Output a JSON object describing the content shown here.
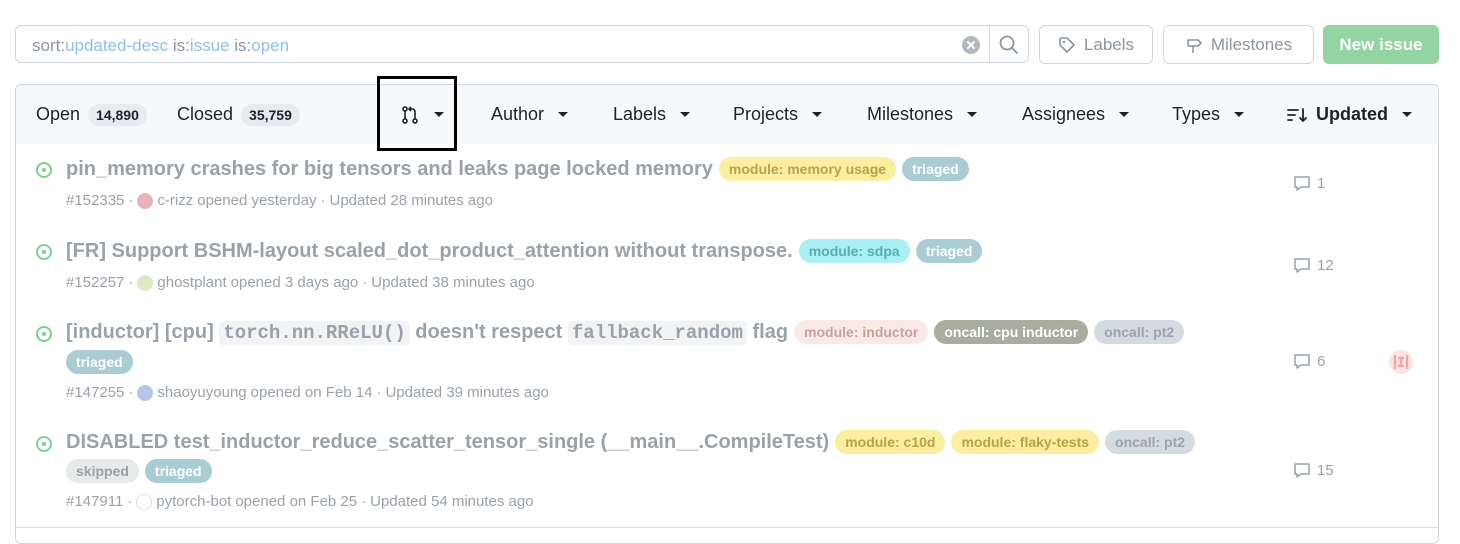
{
  "search": {
    "parts": [
      {
        "k": "sort:",
        "v": "updated-desc"
      },
      {
        "k": " is:",
        "v": "issue"
      },
      {
        "k": " is:",
        "v": "open"
      }
    ]
  },
  "toolbar": {
    "labels_btn": "Labels",
    "milestones_btn": "Milestones",
    "new_issue_btn": "New issue"
  },
  "filters": {
    "open_label": "Open",
    "open_count": "14,890",
    "closed_label": "Closed",
    "closed_count": "35,759",
    "author": "Author",
    "labels": "Labels",
    "projects": "Projects",
    "milestones": "Milestones",
    "assignees": "Assignees",
    "types": "Types",
    "sort": "Updated"
  },
  "colors": {
    "open_icon": "#7fcf92",
    "new_issue_bg": "#94d3a2"
  },
  "issues": [
    {
      "title": "pin_memory crashes for big tensors and leaks page locked memory",
      "labels": [
        {
          "text": "module: memory usage",
          "bg": "#fbeea0",
          "fg": "#b5a44a"
        },
        {
          "text": "triaged",
          "bg": "#a9cdd3",
          "fg": "#ffffff"
        }
      ],
      "number": "#152335",
      "author": "c-rizz",
      "opened": "opened yesterday",
      "updated": "Updated 28 minutes ago",
      "comments": "1"
    },
    {
      "title": "[FR] Support BSHM-layout scaled_dot_product_attention without transpose.",
      "labels": [
        {
          "text": "module: sdpa",
          "bg": "#a8f0f2",
          "fg": "#5aaeb2"
        },
        {
          "text": "triaged",
          "bg": "#a9cdd3",
          "fg": "#ffffff"
        }
      ],
      "number": "#152257",
      "author": "ghostplant",
      "opened": "opened 3 days ago",
      "updated": "Updated 38 minutes ago",
      "comments": "12"
    },
    {
      "title_parts": [
        "[inductor] [cpu] ",
        "torch.nn.RReLU()",
        " doesn't respect ",
        "fallback_random",
        " flag"
      ],
      "labels": [
        {
          "text": "module: inductor",
          "bg": "#fbe9e7",
          "fg": "#c3a39d"
        },
        {
          "text": "oncall: cpu inductor",
          "bg": "#a9ad9f",
          "fg": "#ffffff"
        },
        {
          "text": "oncall: pt2",
          "bg": "#d5dbe3",
          "fg": "#9aa4b0"
        },
        {
          "text": "triaged",
          "bg": "#a9cdd3",
          "fg": "#ffffff"
        }
      ],
      "number": "#147255",
      "author": "shaoyuyoung",
      "opened": "opened on Feb 14",
      "updated": "Updated 39 minutes ago",
      "comments": "6"
    },
    {
      "title": "DISABLED test_inductor_reduce_scatter_tensor_single (__main__.CompileTest)",
      "labels": [
        {
          "text": "module: c10d",
          "bg": "#fbeea0",
          "fg": "#b5a44a"
        },
        {
          "text": "module: flaky-tests",
          "bg": "#fbeea0",
          "fg": "#b5a44a"
        },
        {
          "text": "oncall: pt2",
          "bg": "#d5dbe3",
          "fg": "#9aa4b0"
        },
        {
          "text": "skipped",
          "bg": "#e6ebea",
          "fg": "#9aa1a9"
        },
        {
          "text": "triaged",
          "bg": "#a9cdd3",
          "fg": "#ffffff"
        }
      ],
      "number": "#147911",
      "author": "pytorch-bot",
      "opened": "opened on Feb 25",
      "updated": "Updated 54 minutes ago",
      "comments": "15"
    }
  ]
}
